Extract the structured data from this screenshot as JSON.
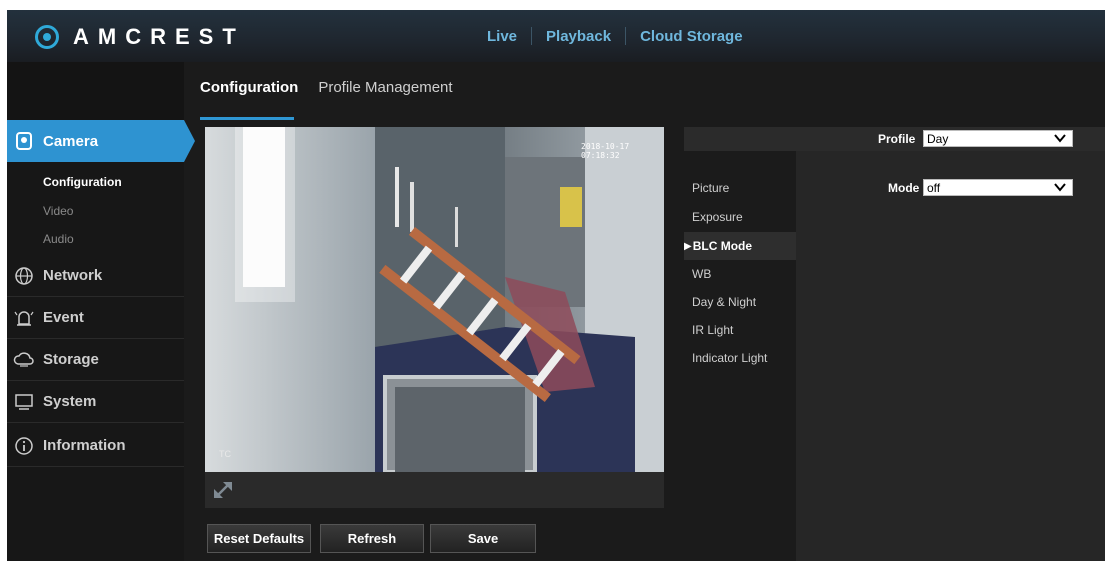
{
  "brand": {
    "name": "AMCREST"
  },
  "top_nav": [
    {
      "label": "Live"
    },
    {
      "label": "Playback"
    },
    {
      "label": "Cloud Storage"
    }
  ],
  "tabs": [
    {
      "label": "Configuration",
      "active": true
    },
    {
      "label": "Profile Management",
      "active": false
    }
  ],
  "sidebar": {
    "categories": [
      {
        "label": "Camera",
        "icon": "camera-icon",
        "active": true
      },
      {
        "label": "Network",
        "icon": "network-globe-icon"
      },
      {
        "label": "Event",
        "icon": "alarm-icon"
      },
      {
        "label": "Storage",
        "icon": "cloud-storage-icon"
      },
      {
        "label": "System",
        "icon": "monitor-icon"
      },
      {
        "label": "Information",
        "icon": "info-icon"
      }
    ],
    "camera_sub": [
      {
        "label": "Configuration",
        "active": true
      },
      {
        "label": "Video"
      },
      {
        "label": "Audio"
      }
    ]
  },
  "video": {
    "timestamp": "2018-10-17 07:18:32",
    "channel_label": "TC"
  },
  "buttons": {
    "reset": "Reset Defaults",
    "refresh": "Refresh",
    "save": "Save"
  },
  "profile": {
    "label": "Profile",
    "value": "Day"
  },
  "settings_menu": [
    {
      "label": "Picture"
    },
    {
      "label": "Exposure"
    },
    {
      "label": "BLC Mode",
      "active": true
    },
    {
      "label": "WB"
    },
    {
      "label": "Day & Night"
    },
    {
      "label": "IR Light"
    },
    {
      "label": "Indicator Light"
    }
  ],
  "mode": {
    "label": "Mode",
    "value": "off"
  },
  "colors": {
    "accent": "#2e93d1",
    "nav_text": "#6fb7dd"
  }
}
